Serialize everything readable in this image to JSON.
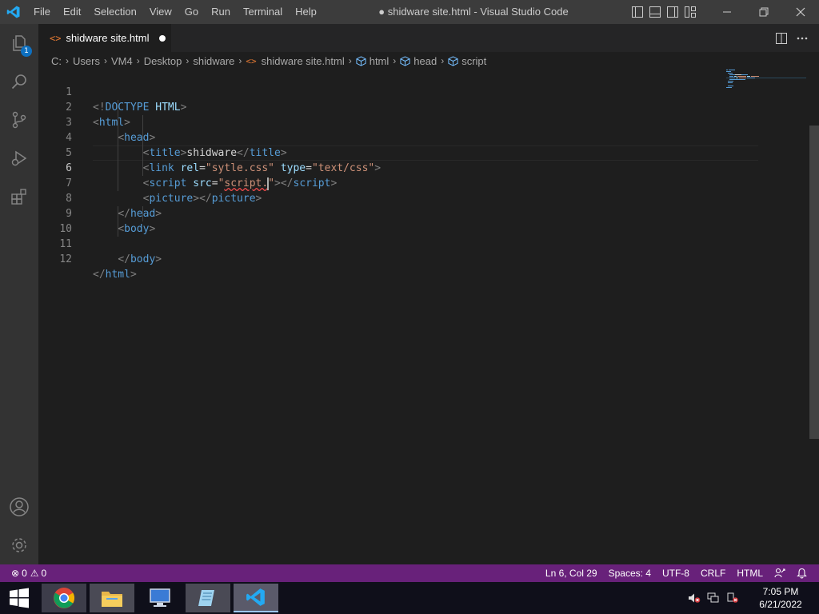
{
  "window": {
    "title": "● shidware site.html - Visual Studio Code"
  },
  "menu": [
    "File",
    "Edit",
    "Selection",
    "View",
    "Go",
    "Run",
    "Terminal",
    "Help"
  ],
  "activity_bar": {
    "explorer_badge": "1",
    "items": [
      "explorer-icon",
      "search-icon",
      "source-control-icon",
      "run-debug-icon",
      "extensions-icon"
    ],
    "bottom_items": [
      "accounts-icon",
      "manage-gear-icon"
    ]
  },
  "tab": {
    "label": "shidware site.html",
    "icon": "<>",
    "dirty": true
  },
  "breadcrumb": {
    "path": [
      "C:",
      "Users",
      "VM4",
      "Desktop",
      "shidware"
    ],
    "file": "shidware site.html",
    "file_icon": "<>",
    "symbols": [
      "html",
      "head",
      "script"
    ]
  },
  "editor": {
    "line_numbers": [
      "1",
      "2",
      "3",
      "4",
      "5",
      "6",
      "7",
      "8",
      "9",
      "10",
      "11",
      "12"
    ],
    "current_line": 6,
    "code": {
      "l1": {
        "open": "<!",
        "tag": "DOCTYPE",
        "attr": "HTML",
        "close": ">"
      },
      "l2": {
        "open": "<",
        "tag": "html",
        "close": ">"
      },
      "l3": {
        "open": "<",
        "tag": "head",
        "close": ">"
      },
      "l4": {
        "open": "<",
        "tag": "title",
        "close": ">",
        "text": "shidware",
        "end_open": "</",
        "end_tag": "title",
        "end_close": ">"
      },
      "l5": {
        "open": "<",
        "tag": "link",
        "attr1": "rel",
        "eq1": "=",
        "val1": "\"sytle.css\"",
        "attr2": "type",
        "eq2": "=",
        "val2": "\"text/css\"",
        "close": ">"
      },
      "l6": {
        "open": "<",
        "tag": "script",
        "attr": "src",
        "eq": "=",
        "q1": "\"",
        "val": "script.",
        "q2": "\"",
        "close": "></",
        "end_tag": "script",
        "end_close": ">"
      },
      "l7": {
        "open": "<",
        "tag": "picture",
        "close": "></",
        "end_tag": "picture",
        "end_close": ">"
      },
      "l8": {
        "open": "</",
        "tag": "head",
        "close": ">"
      },
      "l9": {
        "open": "<",
        "tag": "body",
        "close": ">"
      },
      "l11": {
        "open": "</",
        "tag": "body",
        "close": ">"
      },
      "l12": {
        "open": "</",
        "tag": "html",
        "close": ">"
      }
    }
  },
  "status_bar": {
    "errors": "0",
    "warnings": "0",
    "cursor": "Ln 6, Col 29",
    "spaces": "Spaces: 4",
    "encoding": "UTF-8",
    "eol": "CRLF",
    "language": "HTML",
    "color": "#68217a"
  },
  "taskbar": {
    "apps": [
      "chrome-icon",
      "file-explorer-icon",
      "remote-desktop-icon",
      "notepad-icon",
      "vscode-icon"
    ],
    "time": "7:05 PM",
    "date": "6/21/2022"
  }
}
